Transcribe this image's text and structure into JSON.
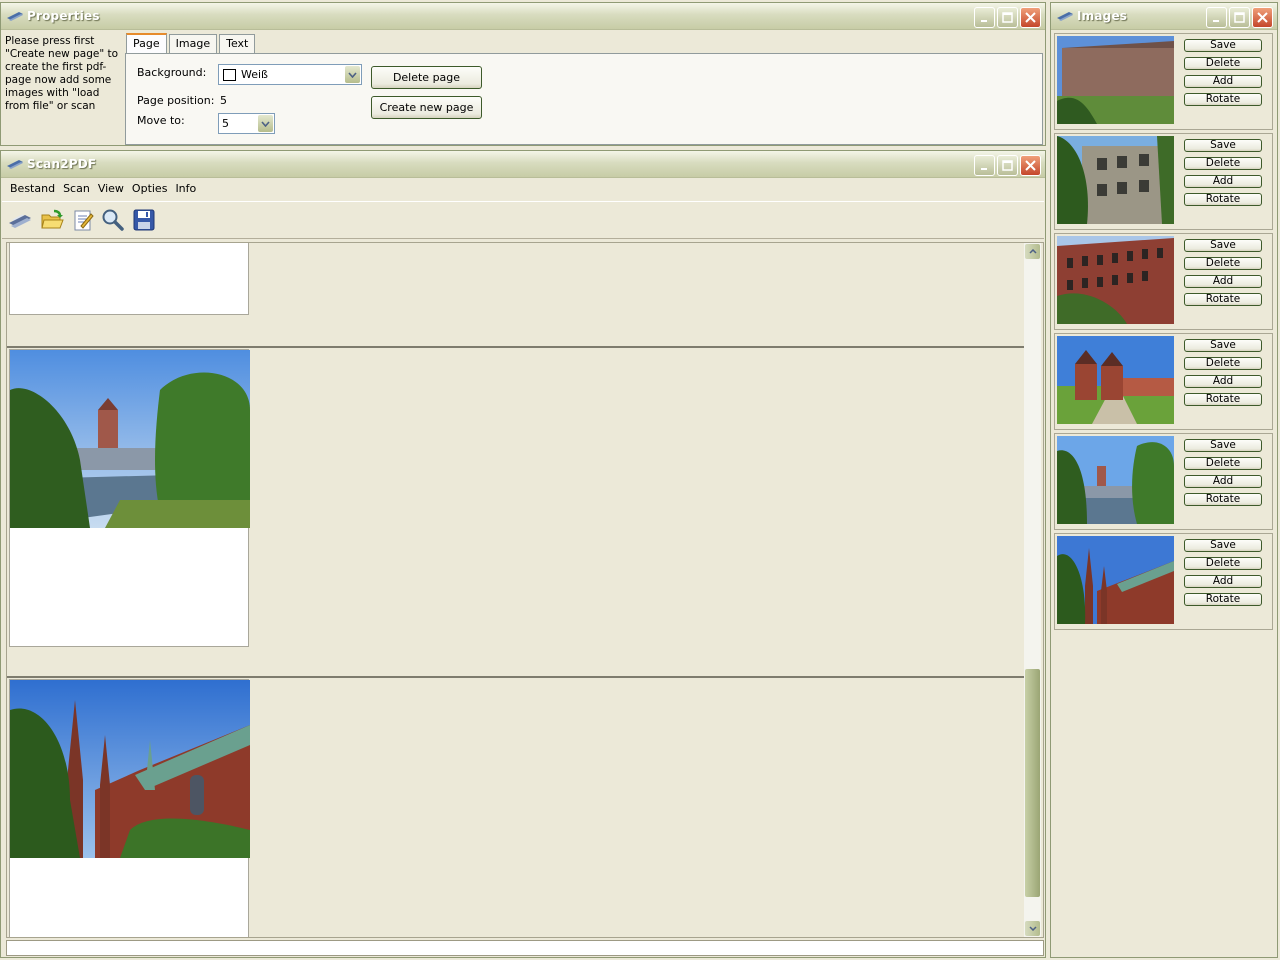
{
  "properties": {
    "title": "Properties",
    "instructions": "Please press first \"Create new page\" to create the first pdf-page now add some images with \"load from file\" or scan",
    "tabs": [
      "Page",
      "Image",
      "Text"
    ],
    "background_label": "Background:",
    "background_value": "Weiß",
    "page_position_label": "Page position:",
    "page_position_value": "5",
    "move_to_label": "Move to:",
    "move_to_value": "5",
    "delete_page": "Delete page",
    "create_new_page": "Create new page"
  },
  "main": {
    "title": "Scan2PDF",
    "menus": [
      "Bestand",
      "Scan",
      "View",
      "Opties",
      "Info"
    ],
    "toolbar": [
      "scanner-icon",
      "open-folder-icon",
      "edit-icon",
      "zoom-icon",
      "save-disk-icon"
    ],
    "status_text": ""
  },
  "images": {
    "title": "Images",
    "button_labels": [
      "Save",
      "Delete",
      "Add",
      "Rotate"
    ],
    "rows": [
      {
        "scene": "building"
      },
      {
        "scene": "ruin"
      },
      {
        "scene": "brick"
      },
      {
        "scene": "gate"
      },
      {
        "scene": "river"
      },
      {
        "scene": "church"
      }
    ]
  },
  "colors": {
    "title_gradient_top": "#f4f5e8",
    "title_gradient_bottom": "#c7cca6",
    "close_button": "#c4472b",
    "window_bg": "#ece9d8",
    "tab_accent": "#e68b2c"
  }
}
